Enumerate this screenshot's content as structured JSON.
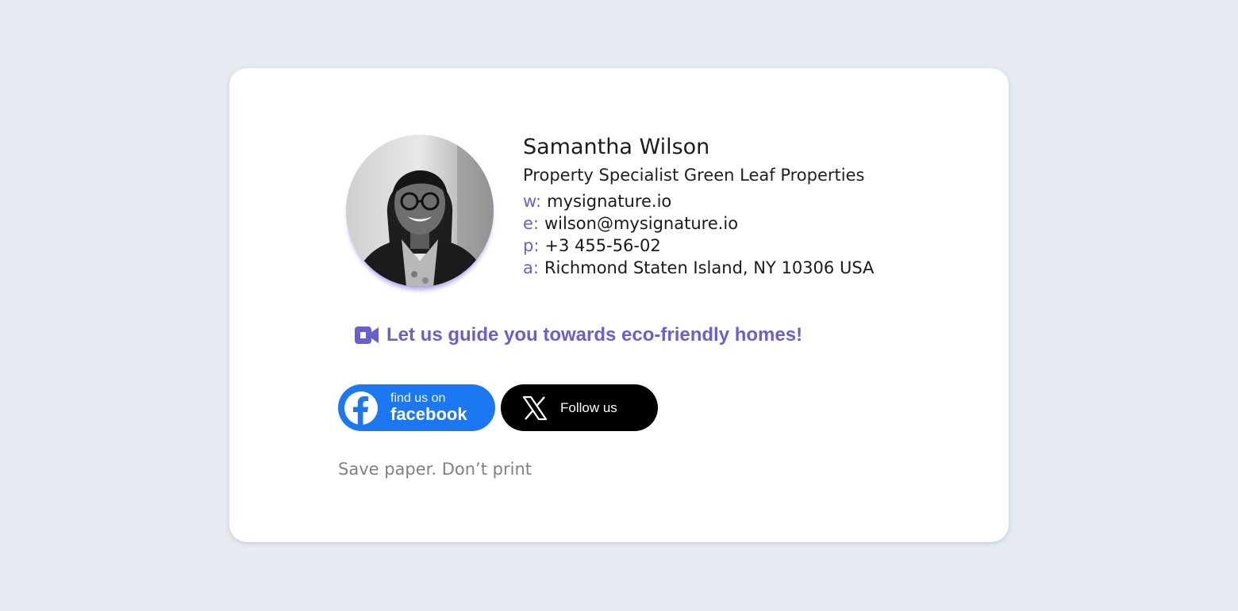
{
  "signature": {
    "name": "Samantha Wilson",
    "title": "Property Specialist Green Leaf Properties",
    "contacts": [
      {
        "key": "w:",
        "value": "mysignature.io"
      },
      {
        "key": "e:",
        "value": "wilson@mysignature.io"
      },
      {
        "key": "p:",
        "value": "+3 455-56-02"
      },
      {
        "key": "a:",
        "value": "Richmond Staten Island, NY 10306 USA"
      }
    ],
    "cta": {
      "icon": "video-camera-icon",
      "text": "Let us guide you towards eco-friendly homes!"
    },
    "social": {
      "facebook": {
        "small": "find us on",
        "big": "facebook",
        "icon": "facebook-icon"
      },
      "x": {
        "label": "Follow us",
        "icon": "x-logo-icon"
      }
    },
    "footer_note": "Save paper. Don’t print"
  },
  "colors": {
    "page_background": "#e6ebf2",
    "card_background": "#ffffff",
    "accent": "#6a5fd0",
    "facebook_blue": "#1b77f2",
    "x_black": "#000000",
    "muted_text": "#808080"
  }
}
